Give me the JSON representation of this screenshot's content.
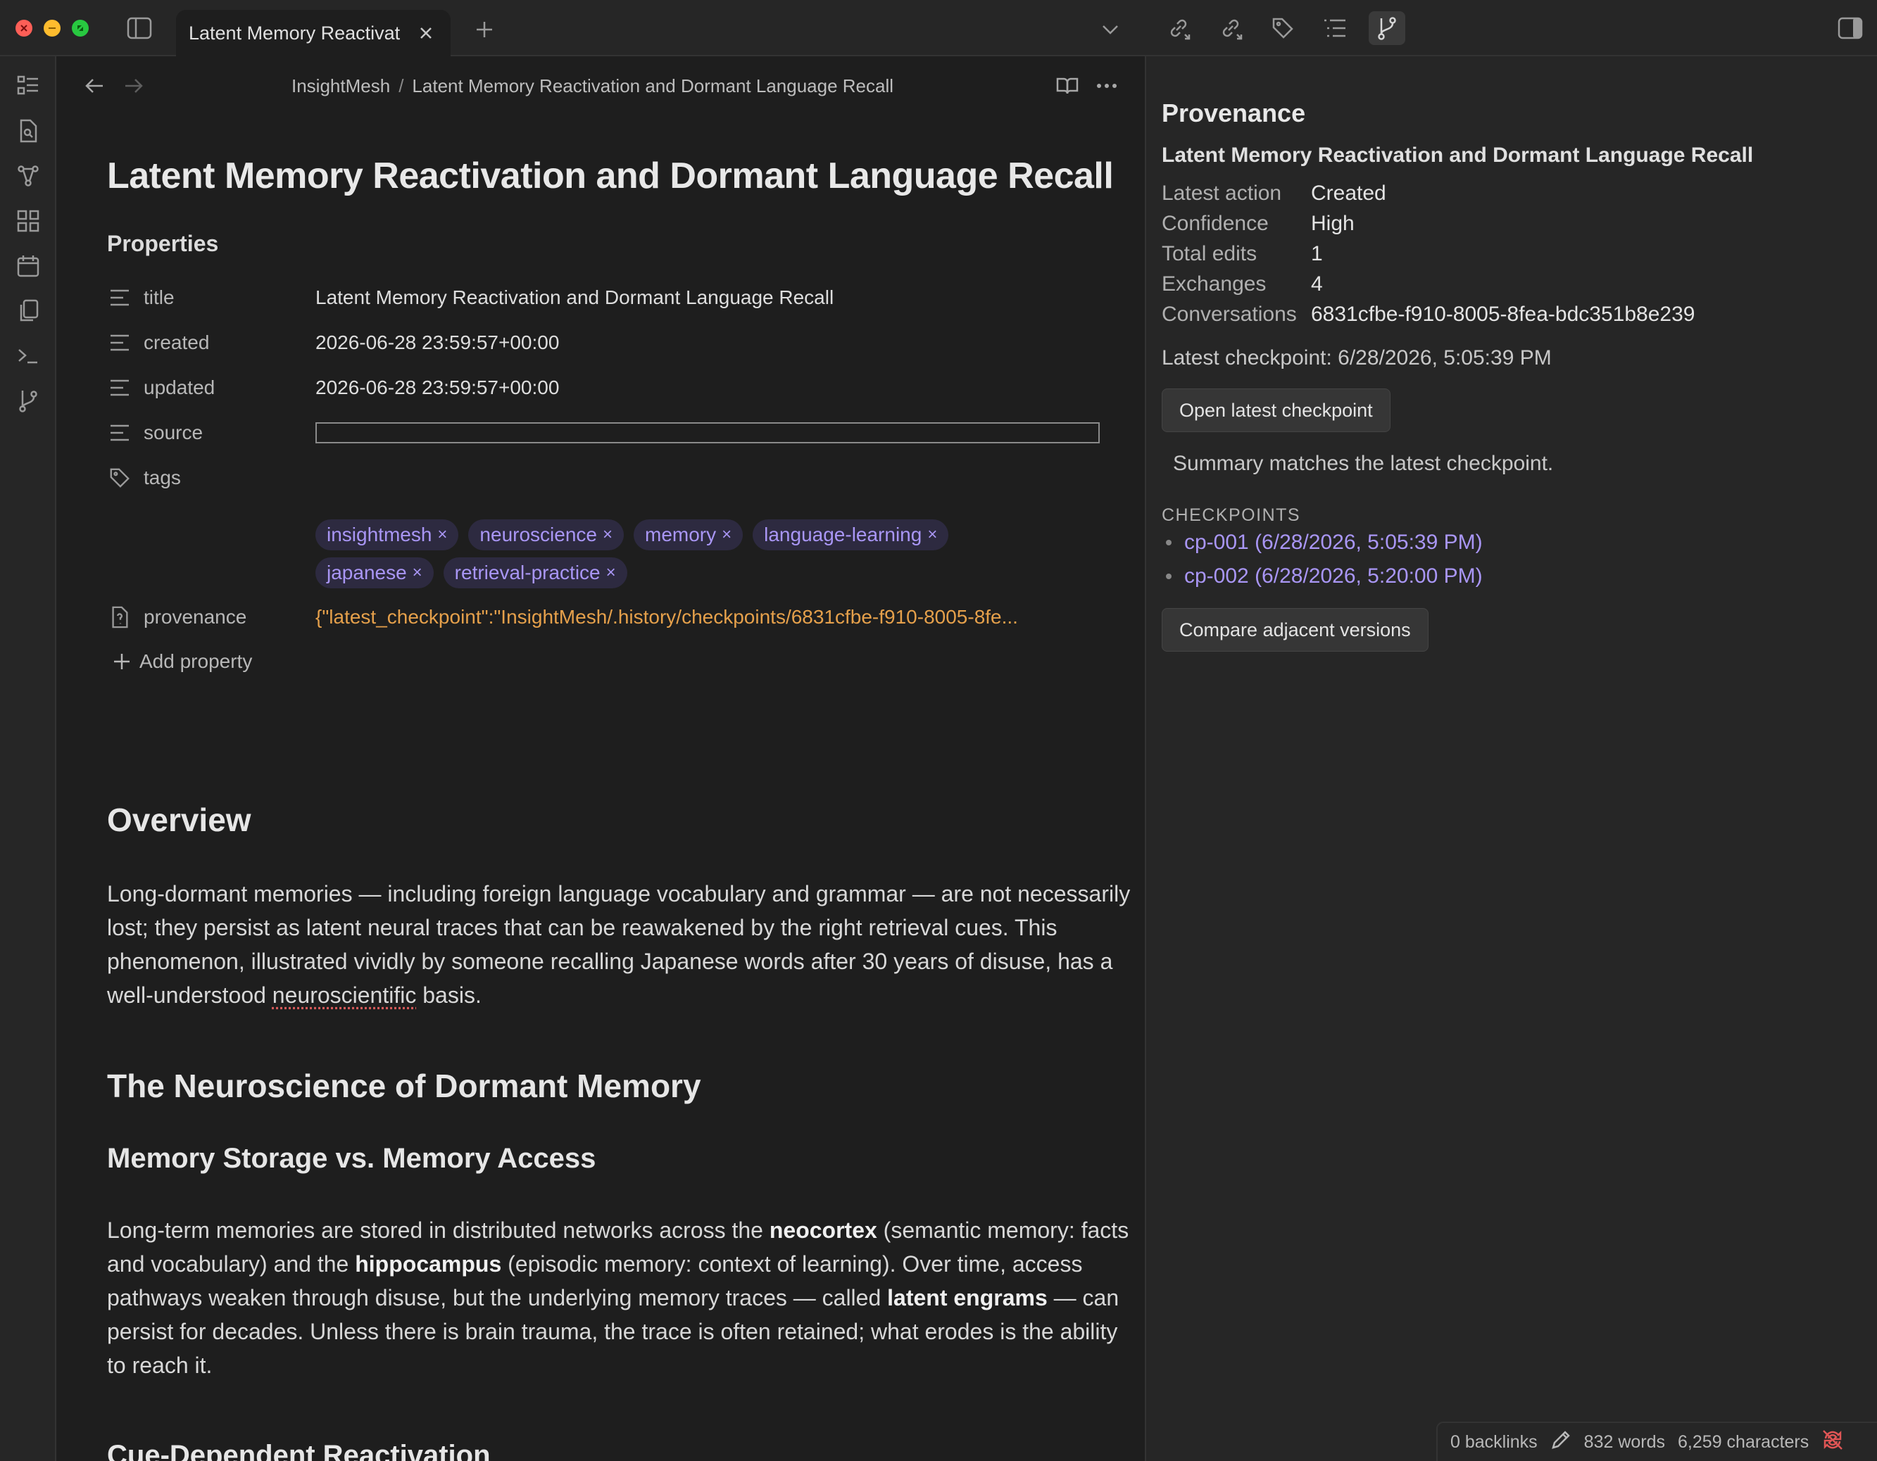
{
  "tab": {
    "title": "Latent Memory Reactivat..."
  },
  "breadcrumb": {
    "vault": "InsightMesh",
    "separator": "/",
    "note": "Latent Memory Reactivation and Dormant Language Recall"
  },
  "note": {
    "title": "Latent Memory Reactivation and Dormant Language Recall",
    "properties_heading": "Properties",
    "properties": [
      {
        "key": "title",
        "value": "Latent Memory Reactivation and Dormant Language Recall",
        "icon": "text-lines-icon"
      },
      {
        "key": "created",
        "value": "2026-06-28 23:59:57+00:00",
        "icon": "text-lines-icon"
      },
      {
        "key": "updated",
        "value": "2026-06-28 23:59:57+00:00",
        "icon": "text-lines-icon"
      },
      {
        "key": "source",
        "value": "",
        "icon": "text-lines-icon"
      },
      {
        "key": "tags",
        "icon": "tags-icon"
      },
      {
        "key": "provenance",
        "value": "{\"latest_checkpoint\":\"InsightMesh/.history/checkpoints/6831cfbe-f910-8005-8fe...",
        "icon": "unknown-type-icon"
      }
    ],
    "tags": [
      "insightmesh",
      "neuroscience",
      "memory",
      "language-learning",
      "japanese",
      "retrieval-practice"
    ],
    "tag_remove_glyph": "×",
    "add_property": "Add property",
    "sections": {
      "overview_heading": "Overview",
      "overview_p1": "Long-dormant memories — including foreign language vocabulary and grammar — are not necessarily lost; they persist as latent neural traces that can be reawakened by the right retrieval cues. This phenomenon, illustrated vividly by someone recalling Japanese words after 30 years of disuse, has a well-understood ",
      "overview_p1_misspelled": "neuroscientific",
      "overview_p1_end": " basis.",
      "neuro_heading": "The Neuroscience of Dormant Memory",
      "storage_heading": "Memory Storage vs. Memory Access",
      "storage_p_a": "Long-term memories are stored in distributed networks across the ",
      "storage_b1": "neocortex",
      "storage_p_b": " (semantic memory: facts and vocabulary) and the ",
      "storage_b2": "hippocampus",
      "storage_p_c": " (episodic memory: context of learning). Over time, access pathways weaken through disuse, but the underlying memory traces — called ",
      "storage_b3": "latent engrams",
      "storage_p_d": " — can persist for decades. Unless there is brain trauma, the trace is often retained; what erodes is the ability to reach it.",
      "cue_heading": "Cue-Dependent Reactivation"
    }
  },
  "provenance_panel": {
    "heading": "Provenance",
    "note_title": "Latent Memory Reactivation and Dormant Language Recall",
    "rows": [
      {
        "k": "Latest action",
        "v": "Created"
      },
      {
        "k": "Confidence",
        "v": "High"
      },
      {
        "k": "Total edits",
        "v": "1"
      },
      {
        "k": "Exchanges",
        "v": "4"
      },
      {
        "k": "Conversations",
        "v": "6831cfbe-f910-8005-8fea-bdc351b8e239"
      }
    ],
    "latest_checkpoint": "Latest checkpoint: 6/28/2026, 5:05:39 PM",
    "open_button": "Open latest checkpoint",
    "summary": "Summary matches the latest checkpoint.",
    "checkpoints_label": "CHECKPOINTS",
    "checkpoints": [
      "cp-001 (6/28/2026, 5:05:39 PM)",
      "cp-002 (6/28/2026, 5:20:00 PM)"
    ],
    "compare_button": "Compare adjacent versions"
  },
  "status": {
    "backlinks": "0 backlinks",
    "words": "832 words",
    "characters": "6,259 characters"
  },
  "colors": {
    "accent": "#a996f5",
    "tag_bg": "#2d2a40",
    "json": "#e5a04b",
    "sync_error": "#e05555"
  }
}
